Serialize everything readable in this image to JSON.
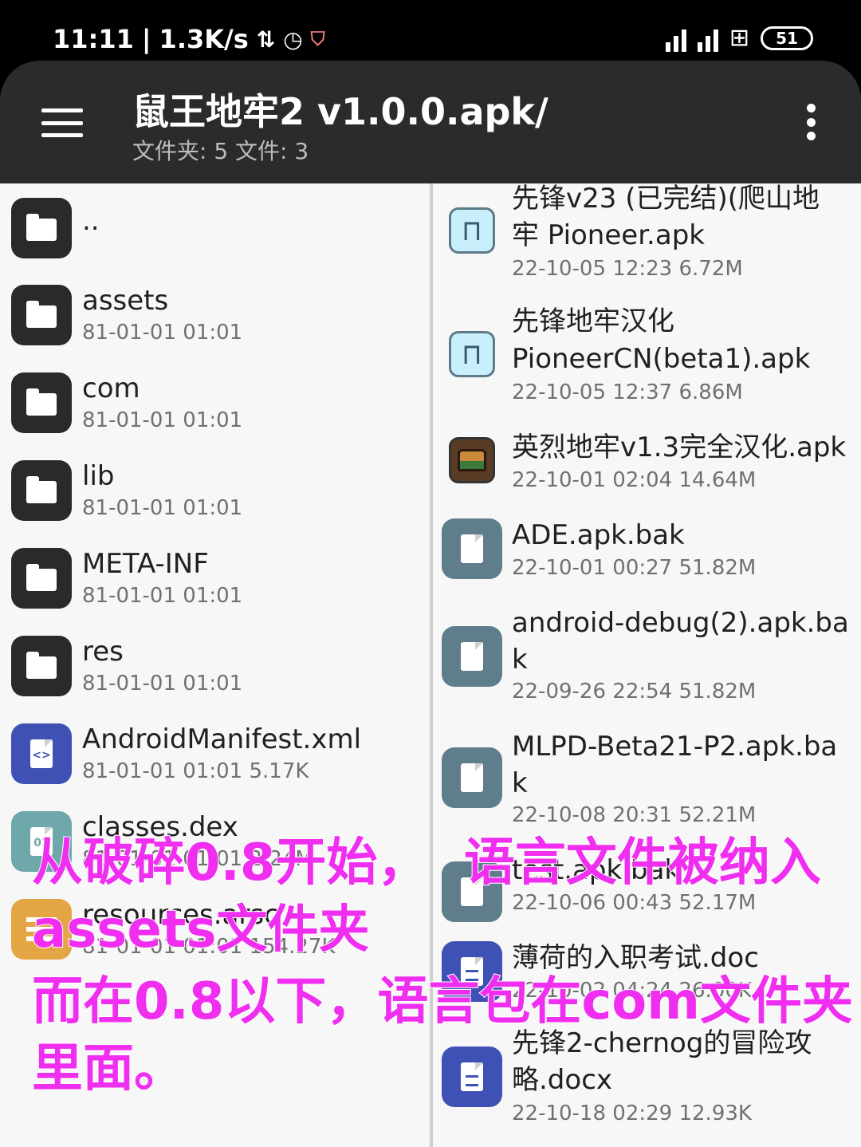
{
  "status_bar": {
    "time": "11:11",
    "separator": "|",
    "speed": "1.3K/s",
    "battery": "51"
  },
  "app_bar": {
    "title": "鼠王地牢2 v1.0.0.apk/",
    "subtitle": "文件夹: 5   文件: 3"
  },
  "left_pane": {
    "items": [
      {
        "name": "..",
        "meta": "",
        "icon": "folder-icon"
      },
      {
        "name": "assets",
        "meta": "81-01-01 01:01",
        "icon": "folder-icon"
      },
      {
        "name": "com",
        "meta": "81-01-01 01:01",
        "icon": "folder-icon"
      },
      {
        "name": "lib",
        "meta": "81-01-01 01:01",
        "icon": "folder-icon"
      },
      {
        "name": "META-INF",
        "meta": "81-01-01 01:01",
        "icon": "folder-icon"
      },
      {
        "name": "res",
        "meta": "81-01-01 01:01",
        "icon": "folder-icon"
      },
      {
        "name": "AndroidManifest.xml",
        "meta": "81-01-01 01:01  5.17K",
        "icon": "xml-file-icon"
      },
      {
        "name": "classes.dex",
        "meta": "81-01-01 01:01  2.24M",
        "icon": "dex-file-icon"
      },
      {
        "name": "resources.arsc",
        "meta": "81-01-01 01:01  154.27K",
        "icon": "layers-file-icon"
      }
    ]
  },
  "right_pane": {
    "items": [
      {
        "name_line1": "先锋v23 (已完结)(爬山地",
        "name_line2": "牢 Pioneer.apk",
        "meta": "22-10-05 12:23  6.72M",
        "icon": "pioneer-apk-icon"
      },
      {
        "name_line1": "先锋地牢汉化",
        "name_line2": "PioneerCN(beta1).apk",
        "meta": "22-10-05 12:37  6.86M",
        "icon": "pioneer-apk-icon"
      },
      {
        "name_line1": "英烈地牢v1.3完全汉化.apk",
        "name_line2": "",
        "meta": "22-10-01 02:04  14.64M",
        "icon": "chest-apk-icon"
      },
      {
        "name_line1": "ADE.apk.bak",
        "name_line2": "",
        "meta": "22-10-01 00:27  51.82M",
        "icon": "file-icon"
      },
      {
        "name_line1": "android-debug(2).apk.ba",
        "name_line2": "k",
        "meta": "22-09-26 22:54  51.82M",
        "icon": "file-icon"
      },
      {
        "name_line1": "MLPD-Beta21-P2.apk.ba",
        "name_line2": "k",
        "meta": "22-10-08 20:31  52.21M",
        "icon": "file-icon"
      },
      {
        "name_line1": "test.apk.bak",
        "name_line2": "",
        "meta": "22-10-06 00:43  52.17M",
        "icon": "file-icon"
      },
      {
        "name_line1": "薄荷的入职考试.doc",
        "name_line2": "",
        "meta": "22-10-02 04:24  26.00K",
        "icon": "doc-icon"
      },
      {
        "name_line1": "先锋2-chernog的冒险攻",
        "name_line2": "略.docx",
        "meta": "22-10-18 02:29  12.93K",
        "icon": "doc-icon"
      }
    ]
  },
  "overlay": {
    "line1": "从破碎0.8开始，  语言文件被纳入assets文件夹",
    "line2": "而在0.8以下，语言包在com文件夹里面。"
  }
}
